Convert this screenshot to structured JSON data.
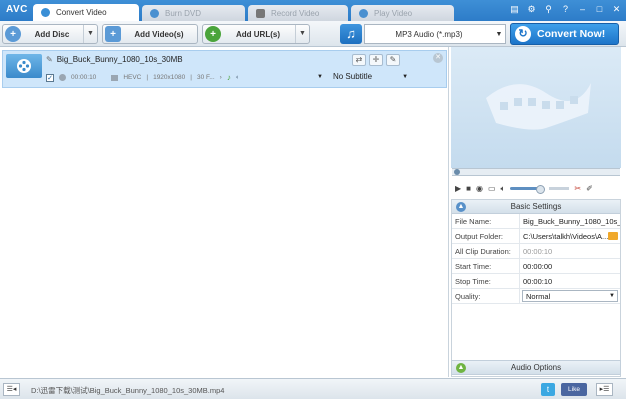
{
  "app": {
    "brand": "AVC",
    "tabs": [
      {
        "label": "Convert Video",
        "active": true
      },
      {
        "label": "Burn DVD",
        "active": false
      },
      {
        "label": "Record Video",
        "active": false
      },
      {
        "label": "Play Video",
        "active": false
      }
    ]
  },
  "toolbar": {
    "add_disc": "Add Disc",
    "add_videos": "Add Video(s)",
    "add_urls": "Add URL(s)",
    "output_format": "MP3 Audio (*.mp3)",
    "convert": "Convert Now!"
  },
  "file": {
    "name": "Big_Buck_Bunny_1080_10s_30MB",
    "duration": "00:00:10",
    "codec": "HEVC",
    "resolution": "1920x1080",
    "fps": "30 F...",
    "subtitle": "No Subtitle"
  },
  "settings": {
    "title": "Basic Settings",
    "rows": [
      {
        "key": "File Name:",
        "value": "Big_Buck_Bunny_1080_10s_3..."
      },
      {
        "key": "Output Folder:",
        "value": "C:\\Users\\talkh\\Videos\\A..."
      },
      {
        "key": "All Clip Duration:",
        "value": "00:00:10"
      },
      {
        "key": "Start Time:",
        "value": "00:00:00"
      },
      {
        "key": "Stop Time:",
        "value": "00:00:10"
      },
      {
        "key": "Quality:",
        "value": "Normal"
      }
    ],
    "audio_options": "Audio Options"
  },
  "status": {
    "path": "D:\\迅雷下载\\测试\\Big_Buck_Bunny_1080_10s_30MB.mp4",
    "like": "Like"
  },
  "colors": {
    "accent": "#2d7cc8",
    "selected_row": "#cfe6fa",
    "convert_button": "#1c74c9"
  }
}
